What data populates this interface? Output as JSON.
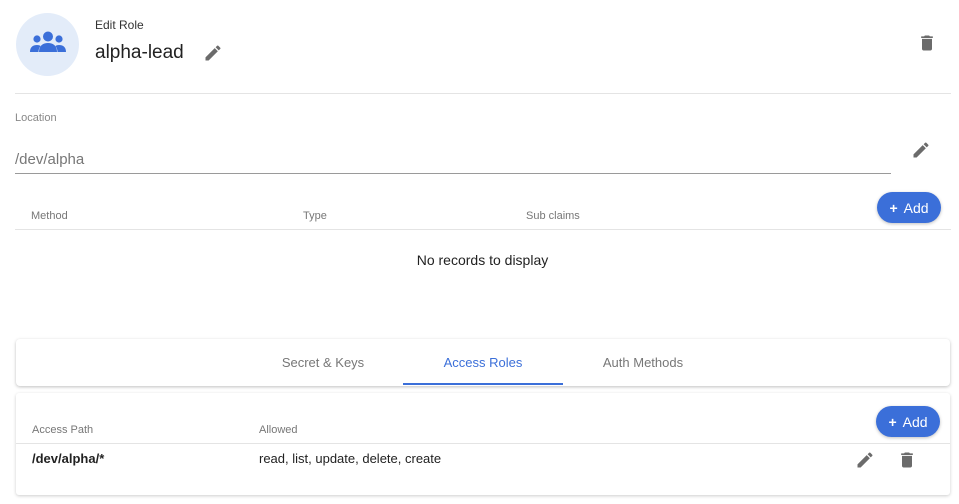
{
  "header": {
    "edit_role_label": "Edit Role",
    "role_name": "alpha-lead",
    "avatar_icon": "users-group-icon",
    "edit_icon": "pencil-icon",
    "delete_icon": "trash-icon"
  },
  "location": {
    "label": "Location",
    "value": "/dev/alpha",
    "edit_icon": "pencil-icon"
  },
  "auth_methods_table": {
    "columns": [
      "Method",
      "Type",
      "Sub claims"
    ],
    "add_label": "Add",
    "empty_text": "No records to display"
  },
  "tabs": [
    {
      "label": "Secret & Keys",
      "active": false
    },
    {
      "label": "Access Roles",
      "active": true
    },
    {
      "label": "Auth Methods",
      "active": false
    }
  ],
  "access_roles_table": {
    "columns": [
      "Access Path",
      "Allowed"
    ],
    "add_label": "Add",
    "rows": [
      {
        "path": "/dev/alpha/*",
        "allowed": "read, list, update, delete, create"
      }
    ]
  },
  "colors": {
    "accent": "#3b6fd9",
    "avatar_bg": "#e3ecf9",
    "icon_gray": "#6b6b6b"
  }
}
